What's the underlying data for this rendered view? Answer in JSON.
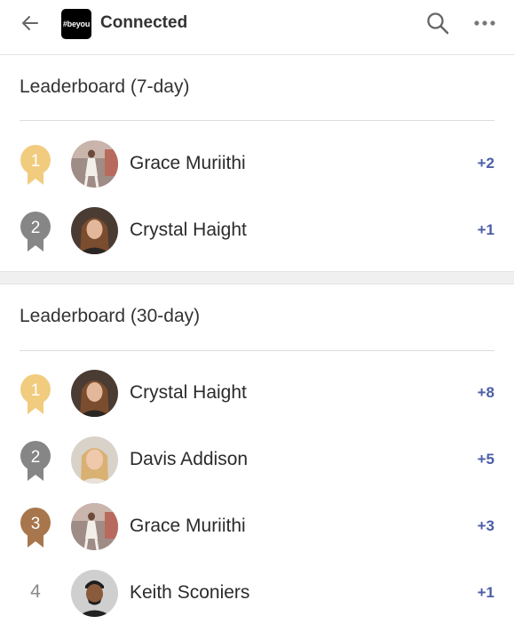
{
  "header": {
    "title": "Connected",
    "logo_text": "#beyou",
    "back_icon": "arrow-left-icon",
    "search_icon": "search-icon",
    "more_icon": "more-horizontal-icon"
  },
  "leaderboard_7": {
    "title": "Leaderboard (7-day)",
    "rows": [
      {
        "rank": "1",
        "name": "Grace Muriithi",
        "score": "+2"
      },
      {
        "rank": "2",
        "name": "Crystal Haight",
        "score": "+1"
      }
    ]
  },
  "leaderboard_30": {
    "title": "Leaderboard (30-day)",
    "rows": [
      {
        "rank": "1",
        "name": "Crystal Haight",
        "score": "+8"
      },
      {
        "rank": "2",
        "name": "Davis Addison",
        "score": "+5"
      },
      {
        "rank": "3",
        "name": "Grace Muriithi",
        "score": "+3"
      },
      {
        "rank": "4",
        "name": "Keith Sconiers",
        "score": "+1"
      }
    ]
  },
  "colors": {
    "gold": "#f1cc7e",
    "silver": "#868686",
    "bronze": "#a8764c",
    "score": "#4a5ea8"
  }
}
